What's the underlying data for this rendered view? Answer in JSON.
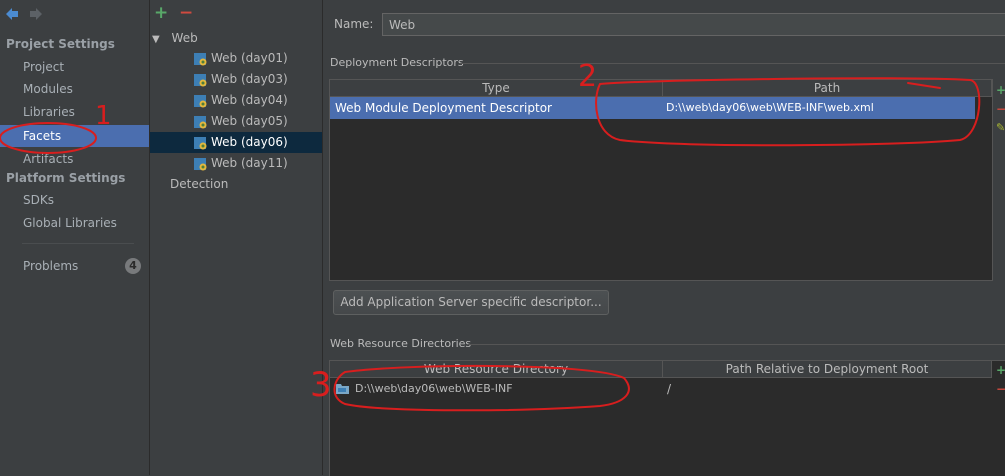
{
  "left_nav": {
    "project_settings_heading": "Project Settings",
    "items": [
      {
        "label": "Project"
      },
      {
        "label": "Modules"
      },
      {
        "label": "Libraries"
      },
      {
        "label": "Facets"
      },
      {
        "label": "Artifacts"
      }
    ],
    "platform_settings_heading": "Platform Settings",
    "platform_items": [
      {
        "label": "SDKs"
      },
      {
        "label": "Global Libraries"
      }
    ],
    "problems": {
      "label": "Problems",
      "count": "4"
    }
  },
  "tree": {
    "add_label": "+",
    "remove_label": "−",
    "root": {
      "expand": "▼",
      "label": "Web"
    },
    "items": [
      {
        "label": "Web (day01)"
      },
      {
        "label": "Web (day03)"
      },
      {
        "label": "Web (day04)"
      },
      {
        "label": "Web (day05)"
      },
      {
        "label": "Web (day06)"
      },
      {
        "label": "Web (day11)"
      }
    ],
    "detection_label": "Detection"
  },
  "facet": {
    "name_label": "Name:",
    "name_value": "Web",
    "deployment": {
      "title": "Deployment Descriptors",
      "columns": [
        "Type",
        "Path"
      ],
      "rows": [
        {
          "type": "Web Module Deployment Descriptor",
          "path": "D:\\\\web\\day06\\web\\WEB-INF\\web.xml"
        }
      ]
    },
    "add_descriptor_button": "Add Application Server specific descriptor...",
    "web_resources": {
      "title": "Web Resource Directories",
      "columns": [
        "Web Resource Directory",
        "Path Relative to Deployment Root"
      ],
      "rows": [
        {
          "directory": "D:\\\\web\\day06\\web\\WEB-INF",
          "relative": "/"
        }
      ]
    }
  },
  "annotations": {
    "one": "1",
    "two": "2",
    "three": "3",
    "color": "#d81e1e"
  },
  "colors": {
    "selection": "#4b6eaf",
    "tree_selection": "#0d293e",
    "add": "#59a869",
    "remove": "#d04a3f"
  }
}
